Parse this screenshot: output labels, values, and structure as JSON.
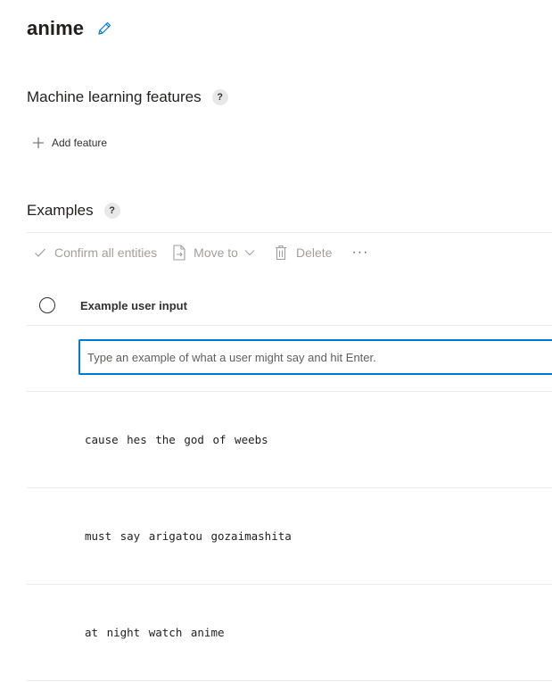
{
  "intent": {
    "name": "anime"
  },
  "ml_features": {
    "title": "Machine learning features",
    "help": "?",
    "add_label": "Add feature"
  },
  "examples": {
    "title": "Examples",
    "help": "?",
    "toolbar": {
      "confirm_label": "Confirm all entities",
      "move_label": "Move to",
      "delete_label": "Delete",
      "more_label": "···"
    },
    "column_header": "Example user input",
    "input_placeholder": "Type an example of what a user might say and hit Enter.",
    "rows": [
      "cause hes the god of weebs",
      "must say arigatou gozaimashita",
      "at night watch anime"
    ]
  },
  "icons": {
    "edit": "pencil-icon",
    "add": "plus-icon",
    "confirm": "checkmark-icon",
    "move": "move-document-icon",
    "move_dropdown": "chevron-down-icon",
    "delete": "trash-icon",
    "more": "ellipsis-icon"
  },
  "colors": {
    "accent": "#0078d4",
    "text": "#201f1e",
    "disabled": "#a19f9d",
    "divider": "#edebe9"
  }
}
